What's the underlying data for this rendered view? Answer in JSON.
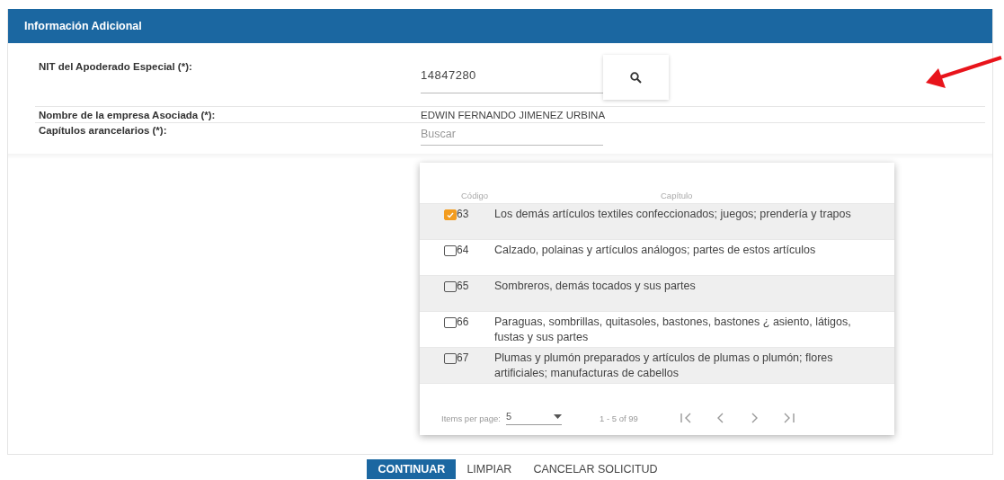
{
  "section": {
    "title": "Información Adicional"
  },
  "fields": [
    {
      "kind": "input",
      "label": "NIT del Apoderado Especial (*):",
      "value": "14847280"
    },
    {
      "kind": "text",
      "label": "Nombre de la empresa Asociada (*):",
      "value": "EDWIN FERNANDO JIMENEZ URBINA"
    },
    {
      "kind": "search",
      "label": "Capítulos arancelarios (*):",
      "placeholder": "Buscar"
    }
  ],
  "chapters_table": {
    "columns": [
      "Código",
      "Capítulo"
    ],
    "rows": [
      {
        "checked": true,
        "code": "63",
        "chapter": "Los demás artículos textiles confeccionados; juegos; prendería y trapos"
      },
      {
        "checked": false,
        "code": "64",
        "chapter": "Calzado, polainas y artículos análogos; partes de estos artículos"
      },
      {
        "checked": false,
        "code": "65",
        "chapter": "Sombreros, demás tocados y sus partes"
      },
      {
        "checked": false,
        "code": "66",
        "chapter": "Paraguas, sombrillas, quitasoles, bastones, bastones ¿ asiento, látigos, fustas y sus partes"
      },
      {
        "checked": false,
        "code": "67",
        "chapter": "Plumas y plumón preparados y artículos de plumas o plumón; flores artificiales; manufacturas de cabellos"
      }
    ],
    "paginator": {
      "items_per_page_label": "Items per page:",
      "page_size": "5",
      "range": "1 - 5 of 99"
    }
  },
  "buttons": [
    {
      "kind": "primary",
      "label": "CONTINUAR"
    },
    {
      "kind": "flat",
      "label": "LIMPIAR"
    },
    {
      "kind": "flat",
      "label": "CANCELAR SOLICITUD"
    }
  ]
}
